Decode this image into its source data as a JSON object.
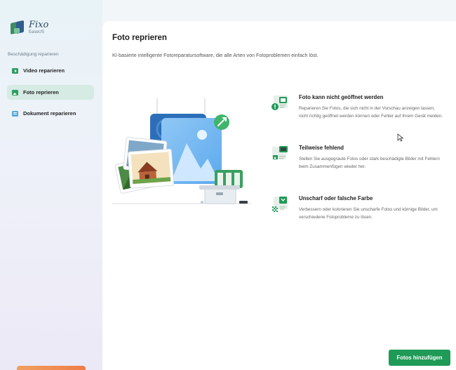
{
  "sidebar": {
    "logo": {
      "name": "Fixo",
      "sub": "EaseUS"
    },
    "section_label": "Beschädigung reparieren",
    "items": [
      {
        "label": "Video reparieren",
        "icon": "video-icon",
        "active": false
      },
      {
        "label": "Foto reprieren",
        "icon": "photo-icon",
        "active": true
      },
      {
        "label": "Dokument reparieren",
        "icon": "document-icon",
        "active": false
      }
    ]
  },
  "main": {
    "title": "Foto reprieren",
    "subtitle": "KI-basierte intelligente Fotoreparatursoftware, die alle Arten von Fotoproblemen einfach löst.",
    "features": [
      {
        "title": "Foto kann nicht geöffnet werden",
        "description": "Reparieren Sie Fotos, die sich nicht in der Vorschau anzeigen lassen, nicht richtig geöffnet werden können oder Fehler auf Ihrem Gerät melden.",
        "icon": "broken-photo-icon"
      },
      {
        "title": "Teilweise fehlend",
        "description": "Stellen Sie ausgegraute Fotos oder stark beschädigte Bilder mit Fehlern beim Zusammenfügen wieder her.",
        "icon": "partial-photo-icon"
      },
      {
        "title": "Unscharf oder falsche Farbe",
        "description": "Verbessern oder kolorieren Sie unscharfe Fotos und körnige Bilder, um verschiedene Fotoprobleme zu lösen.",
        "icon": "blurry-photo-icon"
      }
    ],
    "add_button": "Fotos hinzufügen"
  },
  "colors": {
    "accent": "#1f9a57",
    "active_item_bg": "#d5ebe3",
    "illustration_blue": "#4ea3ee"
  }
}
